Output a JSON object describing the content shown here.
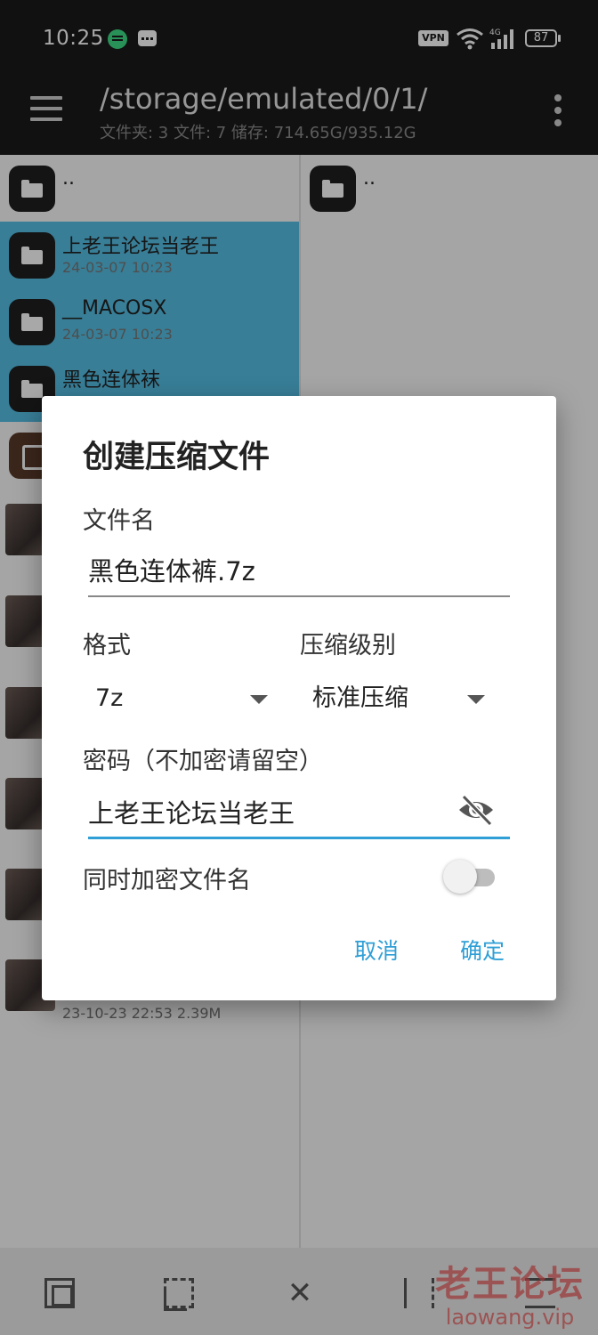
{
  "status_bar": {
    "time": "10:25",
    "vpn_label": "VPN",
    "battery": "87",
    "icons": [
      "spotify-icon",
      "message-icon",
      "vpn-icon",
      "wifi-icon",
      "4g-signal-icon",
      "battery-icon"
    ]
  },
  "app_bar": {
    "path": "/storage/emulated/0/1/",
    "summary": "文件夹: 3  文件: 7  储存: 714.65G/935.12G"
  },
  "left_pane": {
    "up_label": "..",
    "items": [
      {
        "name": "上老王论坛当老王",
        "meta": "24-03-07 10:23"
      },
      {
        "name": "__MACOSX",
        "meta": "24-03-07 10:23"
      },
      {
        "name": "黑色连体袜",
        "meta": ""
      }
    ],
    "last_meta": "23-10-23 22:53  2.39M"
  },
  "right_pane": {
    "up_label": ".."
  },
  "dialog": {
    "title": "创建压缩文件",
    "filename_label": "文件名",
    "filename_value": "黑色连体裤.7z",
    "format_label": "格式",
    "format_value": "7z",
    "level_label": "压缩级别",
    "level_value": "标准压缩",
    "password_label": "密码（不加密请留空）",
    "password_value": "上老王论坛当老王",
    "encrypt_names_label": "同时加密文件名",
    "encrypt_names_enabled": false,
    "cancel_label": "取消",
    "ok_label": "确定",
    "accent_color": "#2f9fd6"
  },
  "bottom_bar": {
    "icons": [
      "select-all-icon",
      "select-none-icon",
      "close-icon",
      "invert-selection-icon",
      "list-icon"
    ],
    "close_glyph": "✕"
  },
  "watermark": {
    "title": "老王论坛",
    "url": "laowang.vip"
  }
}
